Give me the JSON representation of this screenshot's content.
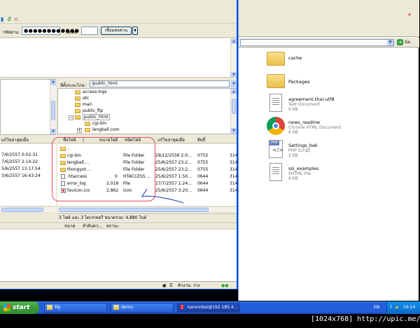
{
  "filezilla": {
    "quickconnect": {
      "password_label": "รหัสผ่าน:",
      "password_value": "●●●●●●●●●●●●",
      "port_label": "พอร์ต:",
      "port_value": "",
      "connect_button": "เชื่อมต่อด่วน"
    },
    "remote_path_label": "ที่ตั้งระยะไกล:",
    "remote_path": "/public_html",
    "tree": [
      "access-logs",
      "etc",
      "mail",
      "public_ftp",
      "public_html",
      "cgi-bin",
      "lengball.com"
    ],
    "local_header": {
      "modified": "แก้ไขล่าสุดเมื่อ"
    },
    "local_rows": [
      "7/6/2557 0:02:31",
      "7/6/2557 2:14:22",
      "5/6/2557 13:17:54",
      "3/6/2557 16:43:24"
    ],
    "remote_header": {
      "name": "ชื่อไฟล์",
      "size": "ขนาดไฟล์",
      "type": "ชนิดไฟล์",
      "modified": "แก้ไขล่าสุดเมื่อ",
      "perms": "สิทธิ์"
    },
    "remote_rows": [
      {
        "name": "..",
        "size": "",
        "type": "",
        "modified": "",
        "perms": "",
        "owner": "",
        "icon": "folder"
      },
      {
        "name": "cgi-bin",
        "size": "",
        "type": "File Folder",
        "modified": "29/12/2556 2:0...",
        "perms": "0755",
        "owner": "314",
        "icon": "folder"
      },
      {
        "name": "lengball....",
        "size": "",
        "type": "File Folder",
        "modified": "25/6/2557 23:2...",
        "perms": "0755",
        "owner": "314",
        "icon": "folder"
      },
      {
        "name": "thongyot....",
        "size": "",
        "type": "File Folder",
        "modified": "25/6/2557 23:2...",
        "perms": "0755",
        "owner": "314",
        "icon": "folder"
      },
      {
        "name": ".htaccess",
        "size": "0",
        "type": "HTACCESS ...",
        "modified": "25/6/2557 1:50...",
        "perms": "0644",
        "owner": "314",
        "icon": "file"
      },
      {
        "name": "error_log",
        "size": "2,018",
        "type": "File",
        "modified": "17/7/2557 1:24...",
        "perms": "0644",
        "owner": "314",
        "icon": "file"
      },
      {
        "name": "favicon.ico",
        "size": "2,862",
        "type": "Icon",
        "modified": "25/6/2557 3:20...",
        "perms": "0644",
        "owner": "314",
        "icon": "ico"
      }
    ],
    "remote_status": "3 ไฟล์ และ 3 ไดเรกทอรี ขนาดรวม: 4,880 ไบต์",
    "queue_header": {
      "size": "ขนาด",
      "priority": "ลำดับคว...",
      "status": "สถานะ"
    },
    "statusbar": {
      "queue": "คิวงาน: ว่าง"
    }
  },
  "explorer": {
    "go_label": "Go",
    "files": [
      {
        "name": "cache",
        "line1": "",
        "line2": "",
        "icon": "folder"
      },
      {
        "name": "Packages",
        "line1": "",
        "line2": "",
        "icon": "folder"
      },
      {
        "name": "agreement.thai-utf8",
        "line1": "Text Document",
        "line2": "9 KB",
        "icon": "text"
      },
      {
        "name": "news_readme",
        "line1": "Chrome HTML Document",
        "line2": "6 KB",
        "icon": "chrome"
      },
      {
        "name": "Settings_bak",
        "line1": "PHP Script",
        "line2": "2 KB",
        "icon": "php"
      },
      {
        "name": "ssi_examples",
        "line1": "SHTML File",
        "line2": "6 KB",
        "icon": "text"
      }
    ]
  },
  "taskbar": {
    "start": "start",
    "tasks": [
      {
        "label": "My",
        "icon": "folder"
      },
      {
        "label": "demo",
        "icon": "folder"
      },
      {
        "label": "kanomkai@192.185.4...",
        "icon": "filezilla"
      }
    ],
    "lang": "EN",
    "clock": "16:14"
  },
  "watermark": "[1024x768] http://upic.me/",
  "colors": {
    "annotation": "#e84a5f",
    "taskbar": "#245edb",
    "start": "#3a9a3a"
  }
}
